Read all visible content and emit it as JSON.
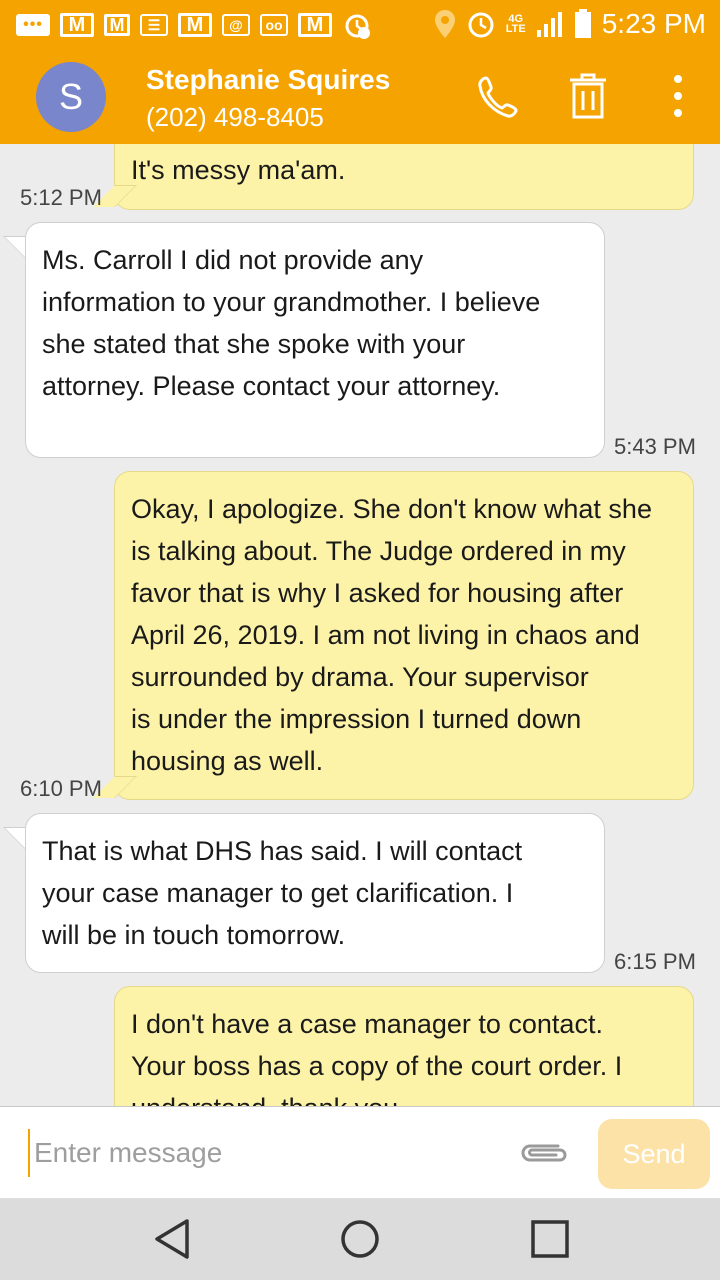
{
  "status_bar": {
    "time": "5:23 PM",
    "network": "4G",
    "network_sub": "LTE",
    "icons": [
      "chat-dots-icon",
      "gmail-icon",
      "gmail-icon",
      "message-icon",
      "gmail-icon",
      "email-at-icon",
      "voicemail-icon",
      "gmail-icon",
      "alarm-notification-icon",
      "location-icon",
      "alarm-icon",
      "signal-icon",
      "battery-icon"
    ],
    "background": "#f5a300"
  },
  "header": {
    "avatar_letter": "S",
    "avatar_color": "#7986cb",
    "name": "Stephanie Squires",
    "phone": "(202) 498-8405"
  },
  "messages": [
    {
      "direction": "outgoing",
      "lines": [
        "It's messy ma'am."
      ],
      "time": "5:12 PM"
    },
    {
      "direction": "incoming",
      "lines": [
        "Ms. Carroll I did not provide any",
        "information to your grandmother. I believe",
        "she stated that she spoke with your",
        "attorney. Please contact your attorney."
      ],
      "time": "5:43 PM"
    },
    {
      "direction": "outgoing",
      "lines": [
        "Okay, I apologize. She don't know what she",
        "is talking about. The Judge ordered in my",
        "favor that is why I asked for housing after",
        "April 26, 2019. I am not living in chaos and",
        "surrounded by drama. Your supervisor",
        "is under the impression I turned down",
        "housing as well."
      ],
      "time": "6:10 PM"
    },
    {
      "direction": "incoming",
      "lines": [
        "That is what DHS has said. I will contact",
        "your case manager to get clarification. I",
        "will be in touch tomorrow."
      ],
      "time": "6:15 PM"
    },
    {
      "direction": "outgoing",
      "lines": [
        "I don't have a case manager to contact.",
        "Your boss has a copy of the court order. I",
        "understand, thank you."
      ],
      "time": ""
    }
  ],
  "composer": {
    "placeholder": "Enter message",
    "value": "",
    "send_label": "Send"
  },
  "nav": {
    "back": "back-icon",
    "home": "home-icon",
    "recents": "recents-icon"
  }
}
